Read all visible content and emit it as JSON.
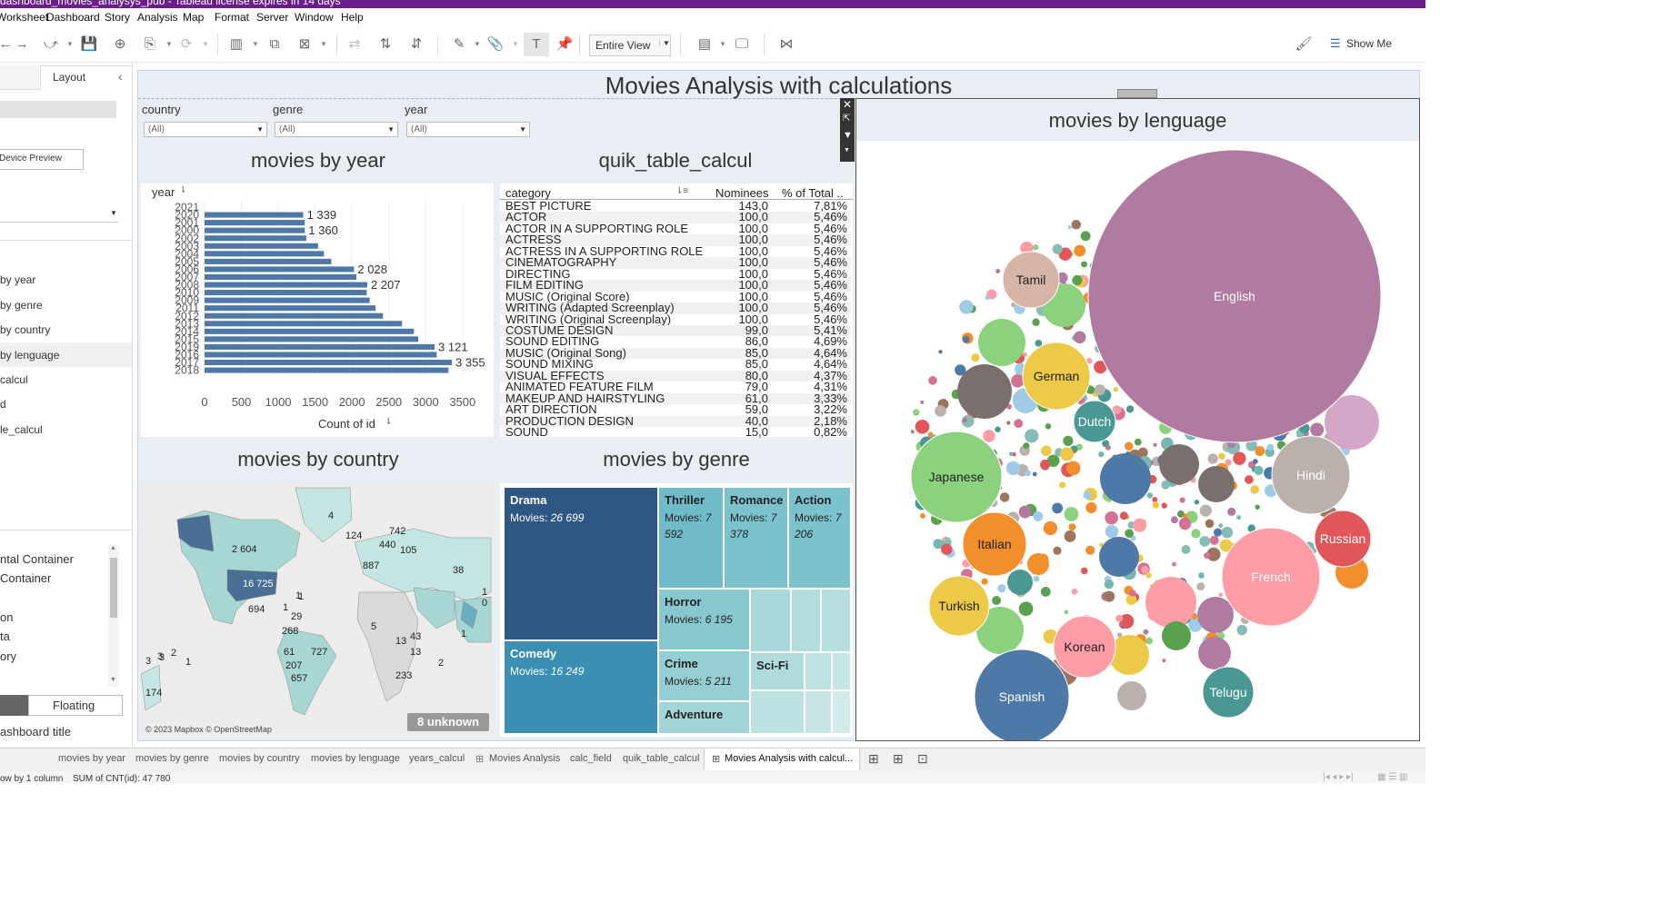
{
  "window": {
    "title": "dashboard_movies_analysys_pub - Tableau license expires in 14 days"
  },
  "menu": [
    "Worksheet",
    "Dashboard",
    "Story",
    "Analysis",
    "Map",
    "Format",
    "Server",
    "Window",
    "Help"
  ],
  "toolbar": {
    "fit_value": "Entire View",
    "show_me": "Show Me"
  },
  "left_pane": {
    "tab_layout": "Layout",
    "device_preview": "Device Preview",
    "sheets": [
      "by year",
      "by genre",
      "by country",
      "by lenguage",
      "calcul",
      "d",
      "le_calcul"
    ],
    "objects": [
      "ntal Container",
      "Container",
      "on",
      "ta",
      "ory"
    ],
    "tiled": "",
    "floating": "Floating",
    "dashboard_title": "ashboard title"
  },
  "dashboard": {
    "title": "Movies Analysis with calculations",
    "filters": [
      {
        "label": "country",
        "value": "(All)"
      },
      {
        "label": "genre",
        "value": "(All)"
      },
      {
        "label": "year",
        "value": "(All)"
      }
    ]
  },
  "year_chart": {
    "title": "movies by year",
    "header": "year",
    "xlabel": "Count of id",
    "ticks": [
      "0",
      "500",
      "1000",
      "1500",
      "2000",
      "2500",
      "3000",
      "3500"
    ]
  },
  "quick_table": {
    "title": "quik_table_calcul",
    "headers": [
      "category",
      "Nominees",
      "% of Total .."
    ],
    "rows": [
      [
        "BEST PICTURE",
        "143,0",
        "7,81%"
      ],
      [
        "ACTOR",
        "100,0",
        "5,46%"
      ],
      [
        "ACTOR IN A SUPPORTING ROLE",
        "100,0",
        "5,46%"
      ],
      [
        "ACTRESS",
        "100,0",
        "5,46%"
      ],
      [
        "ACTRESS IN A SUPPORTING ROLE",
        "100,0",
        "5,46%"
      ],
      [
        "CINEMATOGRAPHY",
        "100,0",
        "5,46%"
      ],
      [
        "DIRECTING",
        "100,0",
        "5,46%"
      ],
      [
        "FILM EDITING",
        "100,0",
        "5,46%"
      ],
      [
        "MUSIC (Original Score)",
        "100,0",
        "5,46%"
      ],
      [
        "WRITING (Adapted Screenplay)",
        "100,0",
        "5,46%"
      ],
      [
        "WRITING (Original Screenplay)",
        "100,0",
        "5,46%"
      ],
      [
        "COSTUME DESIGN",
        "99,0",
        "5,41%"
      ],
      [
        "SOUND EDITING",
        "86,0",
        "4,69%"
      ],
      [
        "MUSIC (Original Song)",
        "85,0",
        "4,64%"
      ],
      [
        "SOUND MIXING",
        "85,0",
        "4,64%"
      ],
      [
        "VISUAL EFFECTS",
        "80,0",
        "4,37%"
      ],
      [
        "ANIMATED FEATURE FILM",
        "79,0",
        "4,31%"
      ],
      [
        "MAKEUP AND HAIRSTYLING",
        "61,0",
        "3,33%"
      ],
      [
        "ART DIRECTION",
        "59,0",
        "3,22%"
      ],
      [
        "PRODUCTION DESIGN",
        "40,0",
        "2,18%"
      ],
      [
        "SOUND",
        "15,0",
        "0,82%"
      ]
    ]
  },
  "country_map": {
    "title": "movies by country",
    "labels": [
      "4",
      "2 604",
      "124",
      "742",
      "440",
      "105",
      "16 725",
      "38",
      "1",
      "3",
      "3",
      "694",
      "1",
      "29",
      "268",
      "61",
      "727",
      "207",
      "657",
      "174",
      "1",
      "1",
      "3",
      "2",
      "1",
      "1 0",
      "2",
      "233",
      "13",
      "43",
      "13",
      "5",
      "887"
    ],
    "attribution": "© 2023 Mapbox © OpenStreetMap",
    "unknown": "8 unknown"
  },
  "genre_treemap": {
    "title": "movies by genre",
    "movies_label": "Movies:",
    "tiles": [
      {
        "name": "Drama",
        "value": "26 699"
      },
      {
        "name": "Comedy",
        "value": "16 249"
      },
      {
        "name": "Thriller",
        "value": "7 592"
      },
      {
        "name": "Romance",
        "value": "7 378"
      },
      {
        "name": "Action",
        "value": "7 206"
      },
      {
        "name": "Horror",
        "value": "6 195"
      },
      {
        "name": "Crime",
        "value": "5 211"
      },
      {
        "name": "Sci-Fi",
        "value": ""
      },
      {
        "name": "Adventure",
        "value": ""
      }
    ]
  },
  "language_bubbles": {
    "title": "movies by lenguage",
    "labels": [
      "English",
      "Tamil",
      "German",
      "Dutch",
      "Japanese",
      "Hindi",
      "Italian",
      "Russian",
      "French",
      "Turkish",
      "Korean",
      "Spanish",
      "Telugu"
    ]
  },
  "sheet_tabs": [
    "movies by year",
    "movies by genre",
    "movies by country",
    "movies by lenguage",
    "years_calcul",
    "Movies Analysis",
    "calc_field",
    "quik_table_calcul",
    "Movies Analysis with calcul..."
  ],
  "status": {
    "left": "ow by 1 column",
    "sum": "SUM of CNT(id): 47 780"
  },
  "chart_data": [
    {
      "type": "bar",
      "title": "movies by year",
      "xlabel": "Count of id",
      "ylabel": "year",
      "categories": [
        "2021",
        "2020",
        "2001",
        "2000",
        "2002",
        "2003",
        "2004",
        "2005",
        "2006",
        "2007",
        "2008",
        "2010",
        "2009",
        "2011",
        "2012",
        "2013",
        "2014",
        "2015",
        "2019",
        "2016",
        "2017",
        "2018"
      ],
      "values": [
        0,
        1339,
        1360,
        1360,
        1380,
        1540,
        1620,
        1720,
        2028,
        2060,
        2207,
        2200,
        2240,
        2320,
        2420,
        2680,
        2840,
        2900,
        3121,
        3150,
        3355,
        3310
      ],
      "data_labels": {
        "2020": "1 339",
        "2000": "1 360",
        "2006": "2 028",
        "2008": "2 207",
        "2019": "3 121",
        "2017": "3 355"
      },
      "xlim": [
        0,
        3700
      ],
      "grid": true
    },
    {
      "type": "table",
      "title": "quik_table_calcul",
      "columns": [
        "category",
        "Nominees",
        "% of Total .."
      ]
    },
    {
      "type": "treemap",
      "title": "movies by genre",
      "categories": [
        "Drama",
        "Comedy",
        "Thriller",
        "Romance",
        "Action",
        "Horror",
        "Crime"
      ],
      "values": [
        26699,
        16249,
        7592,
        7378,
        7206,
        6195,
        5211
      ]
    },
    {
      "type": "bubble",
      "title": "movies by lenguage",
      "categories": [
        "English",
        "Tamil",
        "German",
        "Dutch",
        "Japanese",
        "Hindi",
        "Italian",
        "Russian",
        "French",
        "Turkish",
        "Korean",
        "Spanish",
        "Telugu"
      ]
    }
  ]
}
